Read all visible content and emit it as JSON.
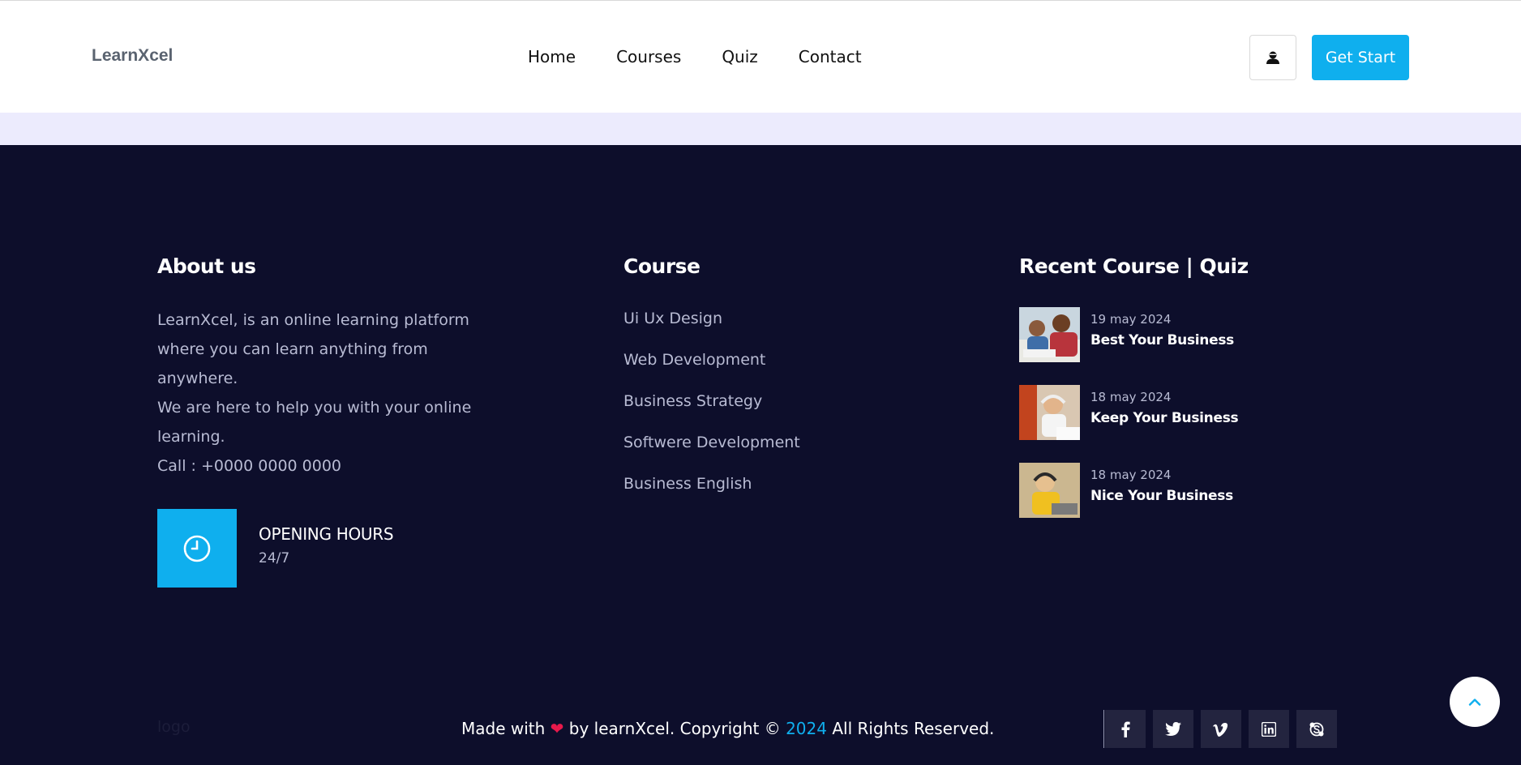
{
  "header": {
    "brand": "LearnXcel",
    "nav": [
      "Home",
      "Courses",
      "Quiz",
      "Contact"
    ],
    "user_icon": "user-icon",
    "cta_label": "Get Start"
  },
  "footer": {
    "about": {
      "title": "About us",
      "paragraph_1": "LearnXcel, is an online learning platform where you can learn anything from anywhere.",
      "paragraph_2": "We are here to help you with your online learning.",
      "call": "Call : +0000 0000 0000",
      "hours_icon": "clock-icon",
      "hours_title": "OPENING HOURS",
      "hours_value": "24/7"
    },
    "course": {
      "title": "Course",
      "items": [
        "Ui Ux Design",
        "Web Development",
        "Business Strategy",
        "Softwere Development",
        "Business English"
      ]
    },
    "recent": {
      "title": "Recent Course | Quiz",
      "items": [
        {
          "date": "19 may 2024",
          "title": "Best Your Business"
        },
        {
          "date": "18 may 2024",
          "title": "Keep Your Business"
        },
        {
          "date": "18 may 2024",
          "title": "Nice Your Business"
        }
      ]
    },
    "bottom": {
      "logo": "logo",
      "made_with": "Made with",
      "by_text": "by learnXcel. Copyright ©",
      "year": "2024",
      "rights": "All Rights Reserved."
    },
    "social": [
      "facebook-icon",
      "twitter-icon",
      "vimeo-icon",
      "linkedin-icon",
      "skype-icon"
    ],
    "scroll_top_icon": "chevron-up-icon"
  },
  "colors": {
    "accent": "#0fafee",
    "footer_bg": "#0d0e2b",
    "band": "#ecebfd",
    "heart": "#e8194b"
  }
}
